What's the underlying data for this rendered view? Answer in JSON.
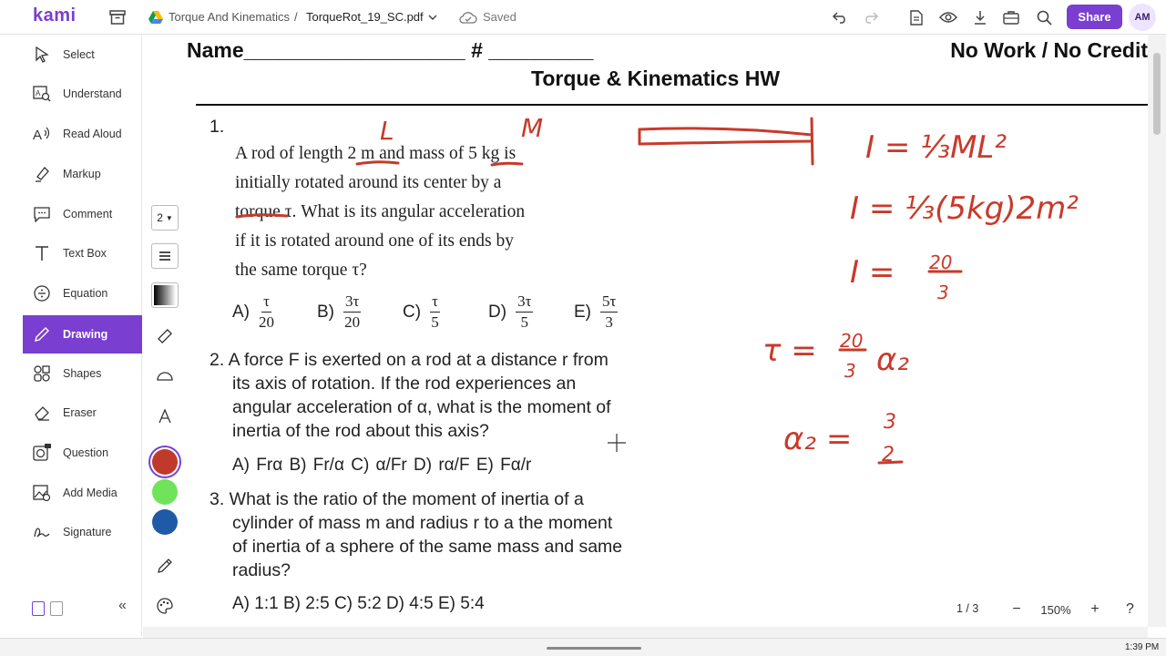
{
  "app": {
    "logo": "kami"
  },
  "topbar": {
    "breadcrumb_folder": "Torque And Kinematics",
    "breadcrumb_sep": "/",
    "file_name": "TorqueRot_19_SC.pdf",
    "status": "Saved",
    "share_label": "Share",
    "avatar_initials": "AM"
  },
  "sidebar": {
    "items": [
      {
        "label": "Select",
        "icon": "cursor-icon"
      },
      {
        "label": "Understand",
        "icon": "dictionary-icon"
      },
      {
        "label": "Read Aloud",
        "icon": "speaker-icon"
      },
      {
        "label": "Markup",
        "icon": "highlighter-icon"
      },
      {
        "label": "Comment",
        "icon": "comment-icon"
      },
      {
        "label": "Text Box",
        "icon": "text-icon"
      },
      {
        "label": "Equation",
        "icon": "equation-icon"
      },
      {
        "label": "Drawing",
        "icon": "pen-icon",
        "active": true
      },
      {
        "label": "Shapes",
        "icon": "shapes-icon"
      },
      {
        "label": "Eraser",
        "icon": "eraser-icon"
      },
      {
        "label": "Question",
        "icon": "question-icon"
      },
      {
        "label": "Add Media",
        "icon": "media-icon"
      },
      {
        "label": "Signature",
        "icon": "signature-icon"
      }
    ]
  },
  "drawbar": {
    "stroke_size": "2",
    "colors": [
      "#c0392b",
      "#6fe35a",
      "#1f5aa6"
    ],
    "selected_color": "#c0392b"
  },
  "document": {
    "header_name": "Name___________________  #  _________",
    "header_right": "No Work / No Credit",
    "title": "Torque & Kinematics HW",
    "q1": {
      "number": "1.",
      "lines": [
        "A rod of length 2 m and mass of 5 kg is",
        "initially rotated around its center by a",
        "torque τ.  What is its angular acceleration",
        "if it is rotated around one of its ends by",
        "the same torque τ?"
      ],
      "options": [
        {
          "label": "A)",
          "num": "τ",
          "den": "20"
        },
        {
          "label": "B)",
          "num": "3τ",
          "den": "20"
        },
        {
          "label": "C)",
          "num": "τ",
          "den": "5"
        },
        {
          "label": "D)",
          "num": "3τ",
          "den": "5"
        },
        {
          "label": "E)",
          "num": "5τ",
          "den": "3"
        }
      ]
    },
    "q2": {
      "lines": [
        "2. A force F is exerted on a rod at a distance r from",
        "its axis of rotation.  If the rod experiences an",
        "angular acceleration of α, what is the moment of",
        "inertia of the rod about this axis?"
      ],
      "options": "A) Frα    B) Fr/α   C) α/Fr   D) rα/F   E) Fα/r"
    },
    "q3": {
      "lines": [
        "3. What is the ratio of the moment of inertia of a",
        "cylinder of mass m and radius r to a the moment",
        "of inertia of a sphere of the same mass and same",
        "radius?"
      ],
      "options": "A)  1:1     B)  2:5     C)  5:2     D)  4:5     E)  5:4"
    },
    "annotations": {
      "L": "L",
      "M": "M",
      "eq1": "I = ⅓ML²",
      "eq2": "I = ⅓(5kg)2m²",
      "eq3_lhs": "I =",
      "eq3_num": "20",
      "eq3_den": "3",
      "tau_lhs": "τ =",
      "tau_num": "20",
      "tau_den": "3",
      "tau_rhs": "α₂",
      "alpha_lhs": "α₂ =",
      "alpha_num": "3",
      "alpha_den": "2"
    }
  },
  "viewer": {
    "page_indicator": "1 / 3",
    "zoom": "150%",
    "help": "?"
  },
  "taskbar": {
    "time": "1:39 PM"
  }
}
